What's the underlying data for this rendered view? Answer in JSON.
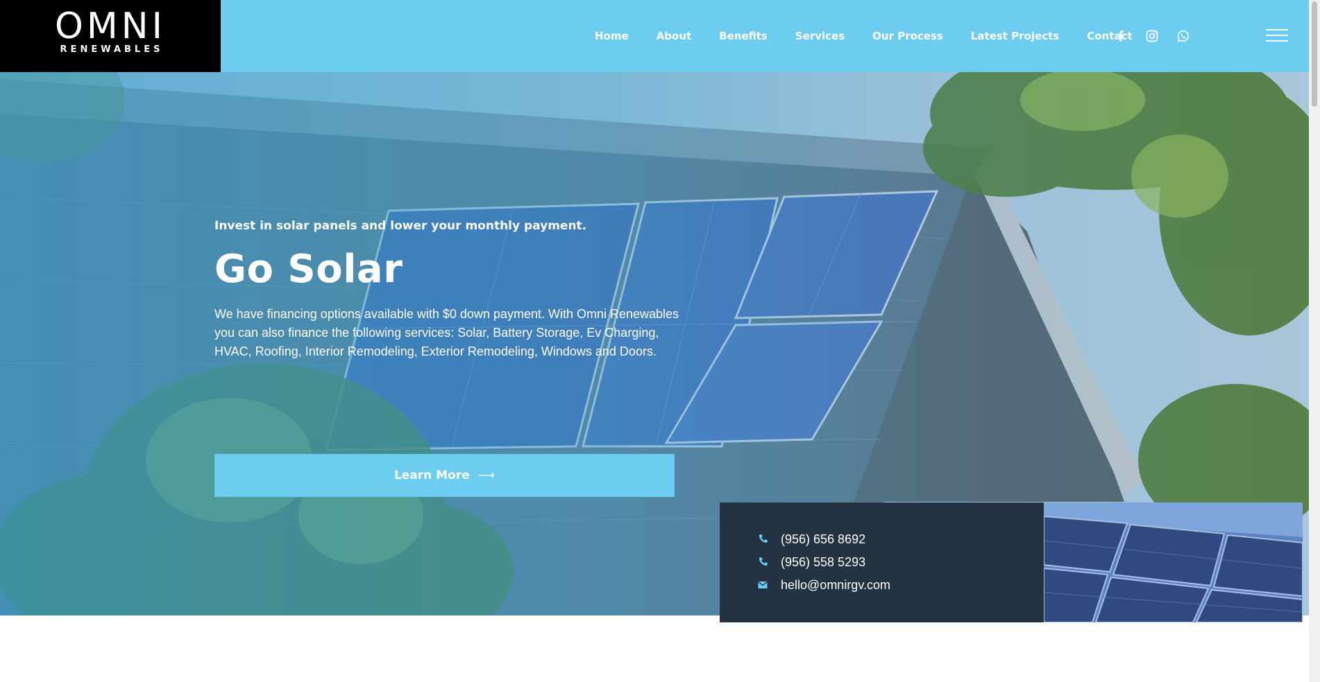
{
  "brand": {
    "name": "OMNI",
    "tagline": "RENEWABLES"
  },
  "nav": {
    "items": [
      {
        "label": "Home"
      },
      {
        "label": "About"
      },
      {
        "label": "Benefits"
      },
      {
        "label": "Services"
      },
      {
        "label": "Our Process"
      },
      {
        "label": "Latest Projects"
      },
      {
        "label": "Contact"
      }
    ],
    "social_icons": [
      "facebook-icon",
      "instagram-icon",
      "whatsapp-icon"
    ],
    "menu_icon": "hamburger-menu-icon"
  },
  "hero": {
    "eyebrow": "Invest in solar panels and lower your monthly payment.",
    "title": "Go Solar",
    "description": "We have financing options available with $0 down payment. With Omni Renewables you can also finance the following services: Solar, Battery Storage, Ev Charging, HVAC, Roofing, Interior Remodeling, Exterior Remodeling, Windows and Doors.",
    "cta_label": "Learn More",
    "cta_arrow": "⟶"
  },
  "contact": {
    "items": [
      {
        "icon": "phone-icon",
        "text": "(956) 656 8692"
      },
      {
        "icon": "phone-icon",
        "text": "(956) 558 5293"
      },
      {
        "icon": "email-icon",
        "text": "hello@omnirgv.com"
      }
    ]
  },
  "colors": {
    "accent": "#6ccdf0",
    "logo_bg": "#000000",
    "contact_bg": "#243342",
    "text_light": "#ffffff"
  }
}
